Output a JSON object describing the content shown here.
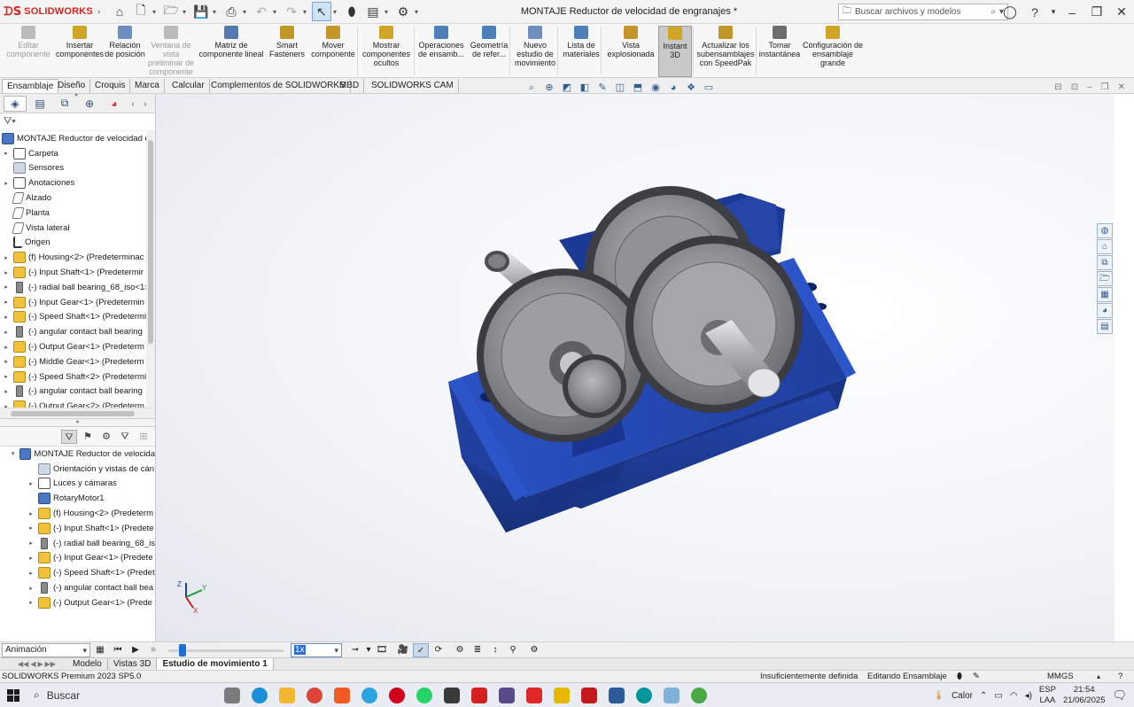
{
  "app": {
    "logo_text": "SOLIDWORKS",
    "doc_title": "MONTAJE Reductor de velocidad de engranajes *",
    "search_placeholder": "Buscar archivos y modelos"
  },
  "ribbon": {
    "buttons": [
      {
        "label": "Editar componente",
        "icon": "edit-component-icon",
        "disabled": true
      },
      {
        "label": "Insertar componentes",
        "icon": "insert-components-icon"
      },
      {
        "label": "Relación de posición",
        "icon": "mate-icon"
      },
      {
        "label": "Ventana de vista preliminar de componente",
        "icon": "preview-window-icon",
        "disabled": true
      },
      {
        "label": "Matriz de componente lineal",
        "icon": "linear-pattern-icon"
      },
      {
        "label": "Smart Fasteners",
        "icon": "smart-fasteners-icon"
      },
      {
        "label": "Mover componente",
        "icon": "move-component-icon"
      },
      {
        "label": "Mostrar componentes ocultos",
        "icon": "show-hidden-icon"
      },
      {
        "label": "Operaciones de ensamb...",
        "icon": "assembly-features-icon"
      },
      {
        "label": "Geometría de refer...",
        "icon": "reference-geometry-icon"
      },
      {
        "label": "Nuevo estudio de movimiento",
        "icon": "motion-study-icon"
      },
      {
        "label": "Lista de materiales",
        "icon": "bom-icon"
      },
      {
        "label": "Vista explosionada",
        "icon": "exploded-view-icon"
      },
      {
        "label": "Instant 3D",
        "icon": "instant3d-icon",
        "active": true
      },
      {
        "label": "Actualizar los subensamblajes con SpeedPak",
        "icon": "speedpak-icon"
      },
      {
        "label": "Tomar instantánea",
        "icon": "snapshot-icon"
      },
      {
        "label": "Configuración de ensamblaje grande",
        "icon": "large-assembly-icon"
      }
    ]
  },
  "tabs": [
    "Ensamblaje",
    "Diseño",
    "Croquis",
    "Marca",
    "Calcular",
    "Complementos de SOLIDWORKS",
    "MBD",
    "SOLIDWORKS CAM"
  ],
  "feature_tree": {
    "root": "MONTAJE Reductor de velocidad de",
    "items": [
      {
        "label": "Carpeta",
        "icon": "folder",
        "exp": true
      },
      {
        "label": "Sensores",
        "icon": "grey",
        "exp": false
      },
      {
        "label": "Anotaciones",
        "icon": "folder",
        "exp": true
      },
      {
        "label": "Alzado",
        "icon": "plane",
        "exp": false
      },
      {
        "label": "Planta",
        "icon": "plane",
        "exp": false
      },
      {
        "label": "Vista lateral",
        "icon": "plane",
        "exp": false
      },
      {
        "label": "Origen",
        "icon": "axis",
        "exp": false
      },
      {
        "label": "(f) Housing<2> (Predeterminac",
        "icon": "yellow",
        "exp": true
      },
      {
        "label": "(-) Input Shaft<1> (Predetermir",
        "icon": "yellow",
        "exp": true
      },
      {
        "label": "(-) radial ball bearing_68_iso<1>",
        "icon": "bear",
        "exp": true
      },
      {
        "label": "(-) Input Gear<1> (Predetermin",
        "icon": "yellow",
        "exp": true
      },
      {
        "label": "(-) Speed Shaft<1> (Predetermi",
        "icon": "yellow",
        "exp": true
      },
      {
        "label": "(-) angular contact ball bearing",
        "icon": "bear",
        "exp": true
      },
      {
        "label": "(-) Output Gear<1> (Predeterm",
        "icon": "yellow",
        "exp": true
      },
      {
        "label": "(-) Middle Gear<1> (Predeterm",
        "icon": "yellow",
        "exp": true
      },
      {
        "label": "(-) Speed Shaft<2> (Predetermi",
        "icon": "yellow",
        "exp": true
      },
      {
        "label": "(-) angular contact ball bearing",
        "icon": "bear",
        "exp": true
      },
      {
        "label": "(-) Output Gear<2> (Predeterm",
        "icon": "yellow",
        "exp": true
      }
    ]
  },
  "motion_tree": {
    "root": "MONTAJE Reductor de velocida",
    "items": [
      {
        "label": "Orientación y vistas de cán",
        "icon": "grey",
        "exp": false
      },
      {
        "label": "Luces y cámaras",
        "icon": "folder",
        "exp": true
      },
      {
        "label": "RotaryMotor1",
        "icon": "blue",
        "exp": false
      },
      {
        "label": "(f) Housing<2> (Predeterm",
        "icon": "yellow",
        "exp": true
      },
      {
        "label": "(-) Input Shaft<1> (Predete",
        "icon": "yellow",
        "exp": true
      },
      {
        "label": "(-) radial ball bearing_68_is",
        "icon": "bear",
        "exp": true
      },
      {
        "label": "(-) Input Gear<1> (Predete",
        "icon": "yellow",
        "exp": true
      },
      {
        "label": "(-) Speed Shaft<1> (Predet",
        "icon": "yellow",
        "exp": true
      },
      {
        "label": "(-) angular contact ball bea",
        "icon": "bear",
        "exp": true
      },
      {
        "label": "(-) Output Gear<1> (Prede",
        "icon": "yellow",
        "exp": true
      }
    ]
  },
  "motion": {
    "study_type": "Animación",
    "speed": "1x",
    "timeline_position": 0.1
  },
  "bottom_tabs": [
    "Modelo",
    "Vistas 3D",
    "Estudio de movimiento 1"
  ],
  "status": {
    "version": "SOLIDWORKS Premium 2023 SP5.0",
    "definition": "Insuficientemente definida",
    "mode": "Editando Ensamblaje",
    "units": "MMGS"
  },
  "taskbar": {
    "search_label": "Buscar",
    "weather": "Calor",
    "lang": "ESP",
    "lang_sub": "LAA",
    "time": "21:54",
    "date": "21/06/2025"
  },
  "colors": {
    "housing": "#1f3f9e",
    "gear": "#7b7d82",
    "accent": "#d7261e"
  }
}
